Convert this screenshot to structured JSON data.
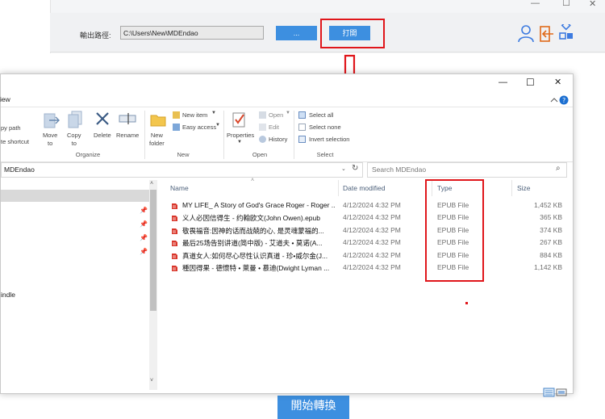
{
  "app": {
    "output_label": "輸出路徑:",
    "output_path": "C:\\Users\\New\\MDEndao",
    "browse_label": "...",
    "open_label": "打開",
    "start_label": "開始轉換",
    "minimize": "—",
    "maximize": "☐",
    "close": "✕",
    "accent_color": "#3d8fe0",
    "highlight_color": "#e0161b"
  },
  "explorer": {
    "window_controls": {
      "minimize": "—",
      "maximize": "☐",
      "close": "✕"
    },
    "menu_view": "iew",
    "ribbon": {
      "copy_path": "py path",
      "paste_shortcut": "te shortcut",
      "move_to": "Move\nto",
      "copy_to": "Copy\nto",
      "delete": "Delete",
      "rename": "Rename",
      "new_folder": "New\nfolder",
      "new_item": "New item",
      "easy_access": "Easy access",
      "properties": "Properties",
      "open": "Open",
      "edit": "Edit",
      "history": "History",
      "select_all": "Select all",
      "select_none": "Select none",
      "invert_selection": "Invert selection",
      "group_organize": "Organize",
      "group_new": "New",
      "group_open": "Open",
      "group_select": "Select"
    },
    "address": "MDEndao",
    "search_placeholder": "Search MDEndao",
    "nav_item": "indle",
    "columns": {
      "name": "Name",
      "date": "Date modified",
      "type": "Type",
      "size": "Size"
    },
    "files": [
      {
        "name": "MY LIFE_ A Story of God's Grace Roger - Roger ...",
        "date": "4/12/2024 4:32 PM",
        "type": "EPUB File",
        "size": "1,452 KB"
      },
      {
        "name": "义人必因信得生 - 约翰欧文(John Owen).epub",
        "date": "4/12/2024 4:32 PM",
        "type": "EPUB File",
        "size": "365 KB"
      },
      {
        "name": "敬畏福音:因神的话而战兢的心, 是灵魂蒙福的...",
        "date": "4/12/2024 4:32 PM",
        "type": "EPUB File",
        "size": "374 KB"
      },
      {
        "name": "最后25场告别讲道(简中版) - 艾道夫 • 莫诺(A...",
        "date": "4/12/2024 4:32 PM",
        "type": "EPUB File",
        "size": "267 KB"
      },
      {
        "name": "真道女人:如何尽心尽性认识真道 - 珍•威尔金(J...",
        "date": "4/12/2024 4:32 PM",
        "type": "EPUB File",
        "size": "884 KB"
      },
      {
        "name": "種因得果 - 德懷特 • 萊曼 • 慕迪(Dwight Lyman ...",
        "date": "4/12/2024 4:32 PM",
        "type": "EPUB File",
        "size": "1,142 KB"
      }
    ]
  }
}
